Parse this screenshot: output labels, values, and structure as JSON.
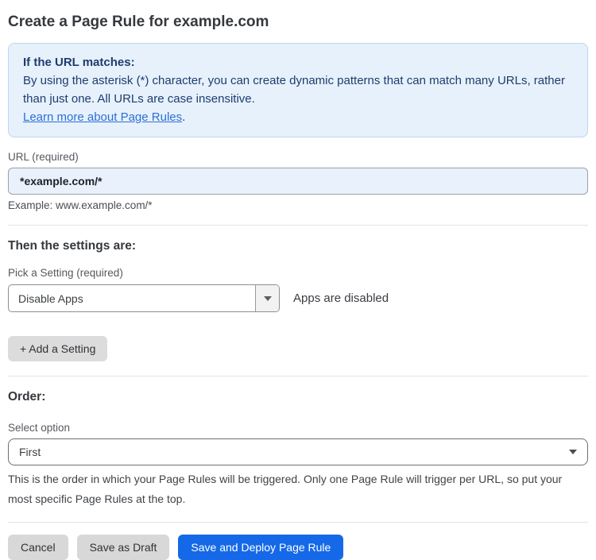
{
  "page": {
    "title": "Create a Page Rule for example.com"
  },
  "info_box": {
    "heading": "If the URL matches:",
    "body": "By using the asterisk (*) character, you can create dynamic patterns that can match many URLs, rather than just one. All URLs are case insensitive.",
    "link_label": "Learn more about Page Rules",
    "link_suffix": "."
  },
  "url_field": {
    "label": "URL (required)",
    "value": "*example.com/*",
    "example": "Example: www.example.com/*"
  },
  "settings_section": {
    "heading": "Then the settings are:",
    "picker_label": "Pick a Setting (required)",
    "selected_setting": "Disable Apps",
    "status_text": "Apps are disabled",
    "add_button_label": "+ Add a Setting"
  },
  "order_section": {
    "heading": "Order:",
    "label": "Select option",
    "selected_option": "First",
    "help_text": "This is the order in which your Page Rules will be triggered. Only one Page Rule will trigger per URL, so put your most specific Page Rules at the top."
  },
  "actions": {
    "cancel_label": "Cancel",
    "save_draft_label": "Save as Draft",
    "save_deploy_label": "Save and Deploy Page Rule"
  },
  "colors": {
    "accent_blue": "#1569e8",
    "info_panel_bg": "#e7f1fb",
    "info_panel_border": "#bcd6ef",
    "info_panel_text": "#1d3d6e",
    "link_blue": "#2c6fd6",
    "url_input_bg": "#e9f1fc",
    "gray_button_bg": "#d8d8d8"
  }
}
